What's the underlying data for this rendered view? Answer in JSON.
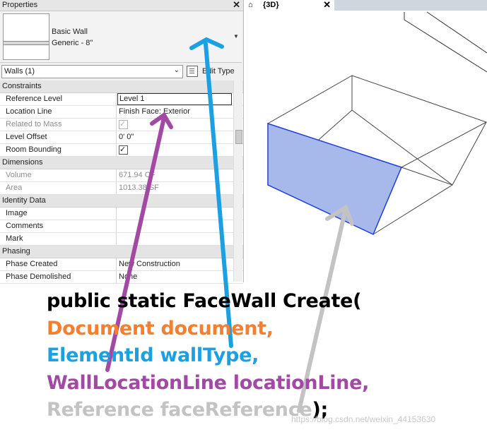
{
  "properties_panel": {
    "title": "Properties",
    "close": "✕",
    "type_family": "Basic Wall",
    "type_name": "Generic - 8\"",
    "selection": "Walls (1)",
    "edit_type": "Edit Type",
    "sections": [
      {
        "name": "Constraints",
        "rows": [
          {
            "key": "Reference Level",
            "value": "Level 1"
          },
          {
            "key": "Location Line",
            "value": "Finish Face: Exterior"
          },
          {
            "key": "Related to Mass",
            "value": ""
          },
          {
            "key": "Level Offset",
            "value": "0'  0\""
          },
          {
            "key": "Room Bounding",
            "value": ""
          }
        ]
      },
      {
        "name": "Dimensions",
        "rows": [
          {
            "key": "Volume",
            "value": "671.94 CF"
          },
          {
            "key": "Area",
            "value": "1013.38 SF"
          }
        ]
      },
      {
        "name": "Identity Data",
        "rows": [
          {
            "key": "Image",
            "value": ""
          },
          {
            "key": "Comments",
            "value": ""
          },
          {
            "key": "Mark",
            "value": ""
          }
        ]
      },
      {
        "name": "Phasing",
        "rows": [
          {
            "key": "Phase Created",
            "value": "New Construction"
          },
          {
            "key": "Phase Demolished",
            "value": "None"
          }
        ]
      }
    ]
  },
  "view": {
    "tab_label": "{3D}",
    "close": "✕"
  },
  "code": {
    "line1": "public static FaceWall Create(",
    "line2": "Document document,",
    "line3": "ElementId wallType,",
    "line4": "WallLocationLine locationLine,",
    "line5": "Reference faceReference",
    "line5_end": ");"
  },
  "colors": {
    "line1": "#000000",
    "line2": "#f57f30",
    "line3": "#1ba1e2",
    "line4": "#a249a4",
    "line5": "#c3c3c3",
    "wall_face": "#a7b8ea"
  },
  "watermark": "https://blog.csdn.net/weixin_44153630"
}
